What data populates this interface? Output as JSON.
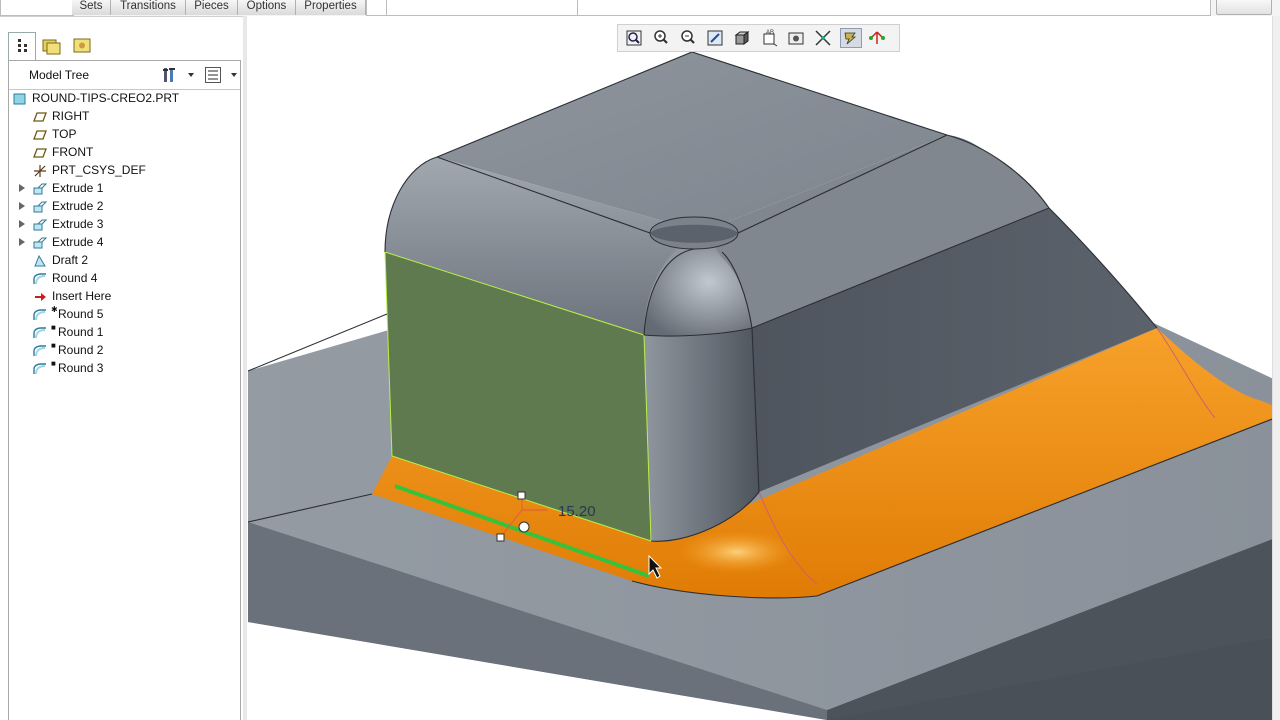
{
  "dashboard_tabs": [
    "Sets",
    "Transitions",
    "Pieces",
    "Options",
    "Properties"
  ],
  "navigator": {
    "tabs": [
      {
        "name": "model-tree-tab-icon",
        "active": true
      },
      {
        "name": "folder-browser-tab-icon",
        "active": false
      },
      {
        "name": "favorites-tab-icon",
        "active": false
      }
    ]
  },
  "model_tree": {
    "title": "Model Tree",
    "root": "ROUND-TIPS-CREO2.PRT",
    "items": [
      {
        "label": "RIGHT",
        "icon": "datum-plane-icon",
        "expandable": false,
        "indent": 0
      },
      {
        "label": "TOP",
        "icon": "datum-plane-icon",
        "expandable": false,
        "indent": 0
      },
      {
        "label": "FRONT",
        "icon": "datum-plane-icon",
        "expandable": false,
        "indent": 0
      },
      {
        "label": "PRT_CSYS_DEF",
        "icon": "coordinate-system-icon",
        "expandable": false,
        "indent": 0
      },
      {
        "label": "Extrude 1",
        "icon": "extrude-icon",
        "expandable": true,
        "indent": 0
      },
      {
        "label": "Extrude 2",
        "icon": "extrude-icon",
        "expandable": true,
        "indent": 0
      },
      {
        "label": "Extrude 3",
        "icon": "extrude-icon",
        "expandable": true,
        "indent": 0
      },
      {
        "label": "Extrude 4",
        "icon": "extrude-icon",
        "expandable": true,
        "indent": 0
      },
      {
        "label": "Draft 2",
        "icon": "draft-icon",
        "expandable": false,
        "indent": 0
      },
      {
        "label": "Round 4",
        "icon": "round-icon",
        "expandable": false,
        "indent": 0
      },
      {
        "label": "Insert Here",
        "icon": "insert-here-arrow-icon",
        "expandable": false,
        "indent": 0
      },
      {
        "label": "Round 5",
        "icon": "round-icon",
        "expandable": false,
        "indent": 1,
        "marker": "✱"
      },
      {
        "label": "Round 1",
        "icon": "round-icon",
        "expandable": false,
        "indent": 1,
        "marker": "■"
      },
      {
        "label": "Round 2",
        "icon": "round-icon",
        "expandable": false,
        "indent": 1,
        "marker": "■"
      },
      {
        "label": "Round 3",
        "icon": "round-icon",
        "expandable": false,
        "indent": 1,
        "marker": "■"
      }
    ]
  },
  "view_toolbar": {
    "buttons": [
      "refit-icon",
      "zoom-in-icon",
      "zoom-out-icon",
      "repaint-icon",
      "display-style-icon",
      "saved-orientations-icon",
      "view-manager-icon",
      "datum-display-icon",
      "spin-center-icon",
      "annotation-display-icon"
    ],
    "active": "spin-center-icon"
  },
  "graphics": {
    "dimension_value": "15.20",
    "highlight_color": "#f08a10",
    "selected_surface_color": "#5e7a4e",
    "edge_highlight_color": "#36c23a",
    "model_color": "#727a84"
  }
}
